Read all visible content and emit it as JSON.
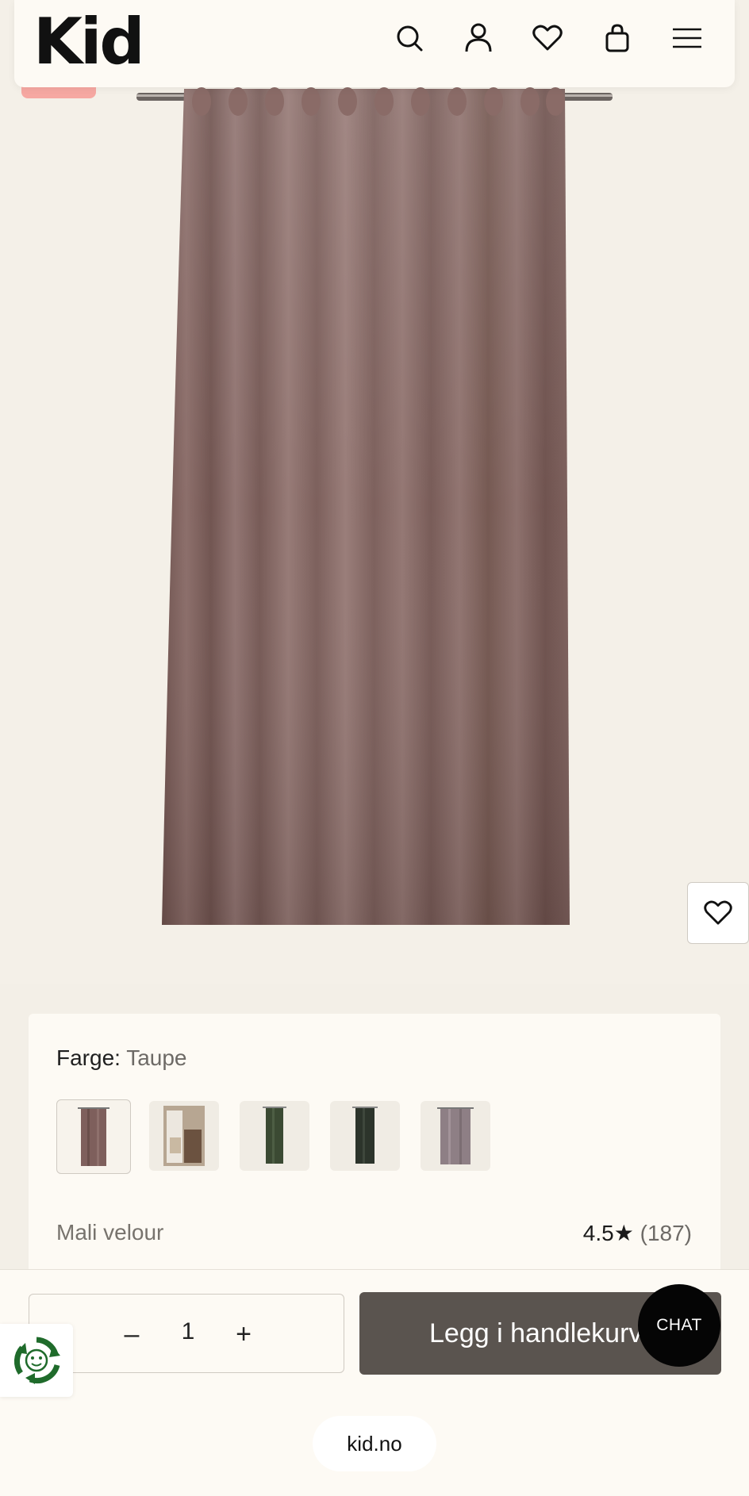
{
  "header": {
    "logo": "Kid",
    "icons": [
      "search-icon",
      "account-icon",
      "wishlist-icon",
      "cart-icon",
      "menu-icon"
    ]
  },
  "product": {
    "color_label": "Farge:",
    "color_value": "Taupe",
    "swatches": [
      {
        "name": "taupe",
        "color": "#7e5f5c",
        "selected": true
      },
      {
        "name": "beige-photo",
        "color": "#9c8a78",
        "selected": false
      },
      {
        "name": "green",
        "color": "#3b4a33",
        "selected": false
      },
      {
        "name": "dark-green",
        "color": "#2c342b",
        "selected": false
      },
      {
        "name": "lilac",
        "color": "#8e7f85",
        "selected": false
      }
    ],
    "name": "Mali velour",
    "rating": "4.5",
    "rating_star": "★",
    "review_count": "(187)"
  },
  "cart": {
    "quantity": "1",
    "minus_symbol": "–",
    "plus_symbol": "+",
    "add_label": "Legg i handlekurv"
  },
  "chat_label": "CHAT",
  "url": "kid.no",
  "colors": {
    "curtain": "#7a5c58",
    "accent_button": "#5a544f",
    "sale_tag": "#f6a8a2",
    "background": "#f3efe7"
  }
}
